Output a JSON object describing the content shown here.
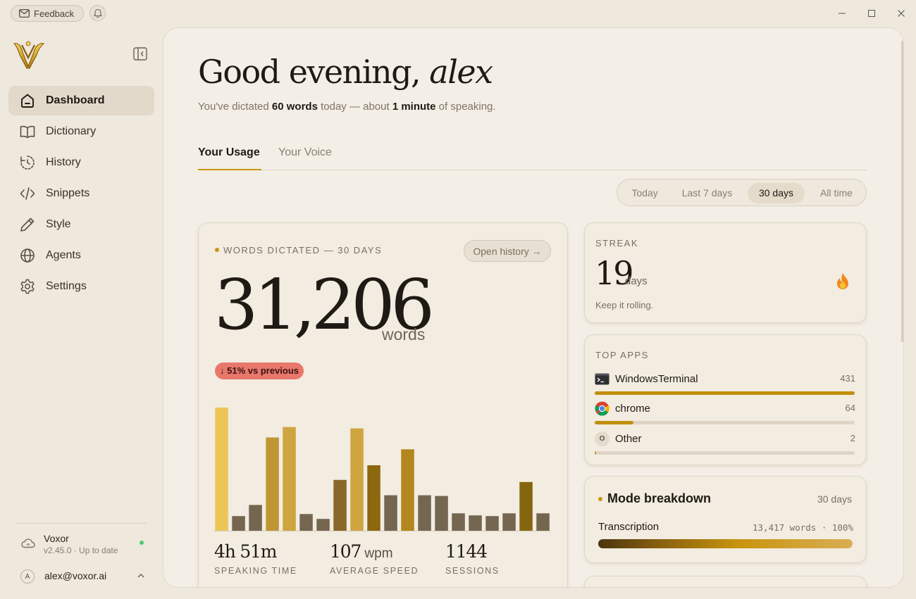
{
  "titlebar": {
    "feedback_label": "Feedback"
  },
  "sidebar": {
    "items": [
      {
        "label": "Dashboard",
        "icon": "home-icon",
        "active": true
      },
      {
        "label": "Dictionary",
        "icon": "book-icon"
      },
      {
        "label": "History",
        "icon": "history-icon"
      },
      {
        "label": "Snippets",
        "icon": "code-icon"
      },
      {
        "label": "Style",
        "icon": "pen-icon"
      },
      {
        "label": "Agents",
        "icon": "globe-icon"
      },
      {
        "label": "Settings",
        "icon": "gear-icon"
      }
    ],
    "app_name": "Voxor",
    "app_version": "v2.45.0 · Up to date",
    "user_initial": "A",
    "user_email": "alex@voxor.ai"
  },
  "header": {
    "greeting_prefix": "Good evening, ",
    "user_name": "alex",
    "sub_prefix": "You've dictated ",
    "sub_words": "60 words",
    "sub_middle": " today — about ",
    "sub_minutes": "1 minute",
    "sub_suffix": " of speaking."
  },
  "tabs": [
    {
      "label": "Your Usage",
      "active": true
    },
    {
      "label": "Your Voice",
      "active": false
    }
  ],
  "range": {
    "options": [
      "Today",
      "Last 7 days",
      "30 days",
      "All time"
    ],
    "selected": "30 days"
  },
  "words_card": {
    "label": "WORDS DICTATED — 30 DAYS",
    "open_history_label": "Open history →",
    "total": "31,206",
    "unit": "words",
    "delta": "↓ 51% vs previous",
    "stats": [
      {
        "value": "4h 51m",
        "unit": "",
        "label": "SPEAKING TIME"
      },
      {
        "value": "107",
        "unit": " wpm",
        "label": "AVERAGE SPEED"
      },
      {
        "value": "1144",
        "unit": "",
        "label": "SESSIONS"
      }
    ]
  },
  "chart_data": {
    "type": "bar",
    "title": "",
    "values": [
      177,
      21,
      37,
      134,
      149,
      24,
      17,
      73,
      147,
      94,
      51,
      117,
      51,
      50,
      25,
      22,
      21,
      25,
      70,
      25
    ],
    "colors": [
      "#ecc557",
      "#756650",
      "#756650",
      "#bf9633",
      "#cfa540",
      "#756650",
      "#756650",
      "#8a6828",
      "#cfa540",
      "#8e680f",
      "#756650",
      "#b2871d",
      "#756650",
      "#756650",
      "#756650",
      "#756650",
      "#756650",
      "#756650",
      "#86650f",
      "#756650"
    ],
    "ylim": [
      0,
      180
    ]
  },
  "streak": {
    "label": "STREAK",
    "value": "19",
    "unit": "days",
    "note": "Keep it rolling."
  },
  "top_apps": {
    "label": "TOP APPS",
    "apps": [
      {
        "name": "WindowsTerminal",
        "count": "431",
        "share": 1.0,
        "icon": "terminal-icon"
      },
      {
        "name": "chrome",
        "count": "64",
        "share": 0.148,
        "icon": "chrome-icon"
      },
      {
        "name": "Other",
        "count": "2",
        "share": 0.005,
        "icon": "other-icon",
        "initial": "O"
      }
    ]
  },
  "mode": {
    "title": "Mode breakdown",
    "period": "30 days",
    "name": "Transcription",
    "stats": "13,417 words · 100%"
  }
}
